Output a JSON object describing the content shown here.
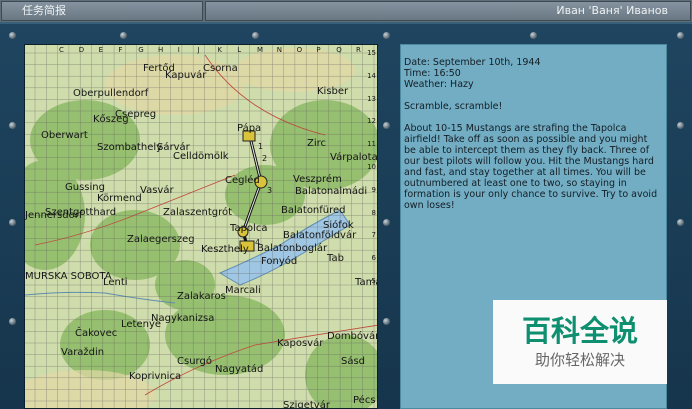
{
  "window": {
    "left_title": "任务简报",
    "right_title": "Иван 'Ваня' Иванов"
  },
  "map": {
    "column_labels": [
      "C",
      "D",
      "E",
      "F",
      "G",
      "H",
      "I",
      "J",
      "K",
      "L",
      "M",
      "N",
      "O",
      "P",
      "Q",
      "R"
    ],
    "row_labels": [
      "15",
      "14",
      "13",
      "12",
      "11",
      "10",
      "9",
      "8",
      "7",
      "6",
      "5"
    ],
    "waypoint_labels": [
      "1",
      "2",
      "3",
      "4"
    ],
    "towns": [
      "Fertőd",
      "Kapuvár",
      "Csorna",
      "Oberpullendorf",
      "Kőszeg",
      "Csepreg",
      "Kisber",
      "Oberwart",
      "Pápa",
      "Zirc",
      "Szombathely",
      "Sárvár",
      "Celldömölk",
      "Várpalota",
      "Gussing",
      "Vasvár",
      "Cegléd",
      "Veszprém",
      "Balatonalmádi",
      "Körmend",
      "Szentgotthard",
      "Zalaszentgrót",
      "Balatonfüred",
      "Jennersdorf",
      "Siófok",
      "Zalaegerszeg",
      "Tapolca",
      "Balatonföldvár",
      "Keszthely",
      "Balatonboglár",
      "Fonyód",
      "Tab",
      "MURSKA SOBOTA",
      "Lenti",
      "Tamási",
      "Marcali",
      "Zalakaros",
      "Nagykanizsa",
      "Letenye",
      "Čakovec",
      "Kaposvár",
      "Dombóvár",
      "Varaždin",
      "Csurgó",
      "Nagyatád",
      "Sásd",
      "Koprivnica",
      "Szigetvár",
      "Pécs"
    ]
  },
  "briefing": {
    "date": "Date: September 10th, 1944",
    "time": "Time: 16:50",
    "weather": "Weather: Hazy",
    "headline": "Scramble, scramble!",
    "body": "About 10-15 Mustangs are strafing the Tapolca airfield! Take off as soon as possible and you might be able to intercept them as they fly back. Three of our best pilots will follow you. Hit the Mustangs hard and fast, and stay together at all times. You will be outnumbered at least one to two, so staying in formation is your only chance to survive. Try to avoid own loses!"
  },
  "watermark": {
    "title": "百科全说",
    "subtitle": "助你轻松解决"
  },
  "colors": {
    "panel": "#72adc4",
    "frame": "#1d4058",
    "lake": "#9fc6e2",
    "forest": "#86b364",
    "route": "#1a1a1a",
    "waypoint": "#d8c33a",
    "watermark_green": "#0e8f70"
  }
}
